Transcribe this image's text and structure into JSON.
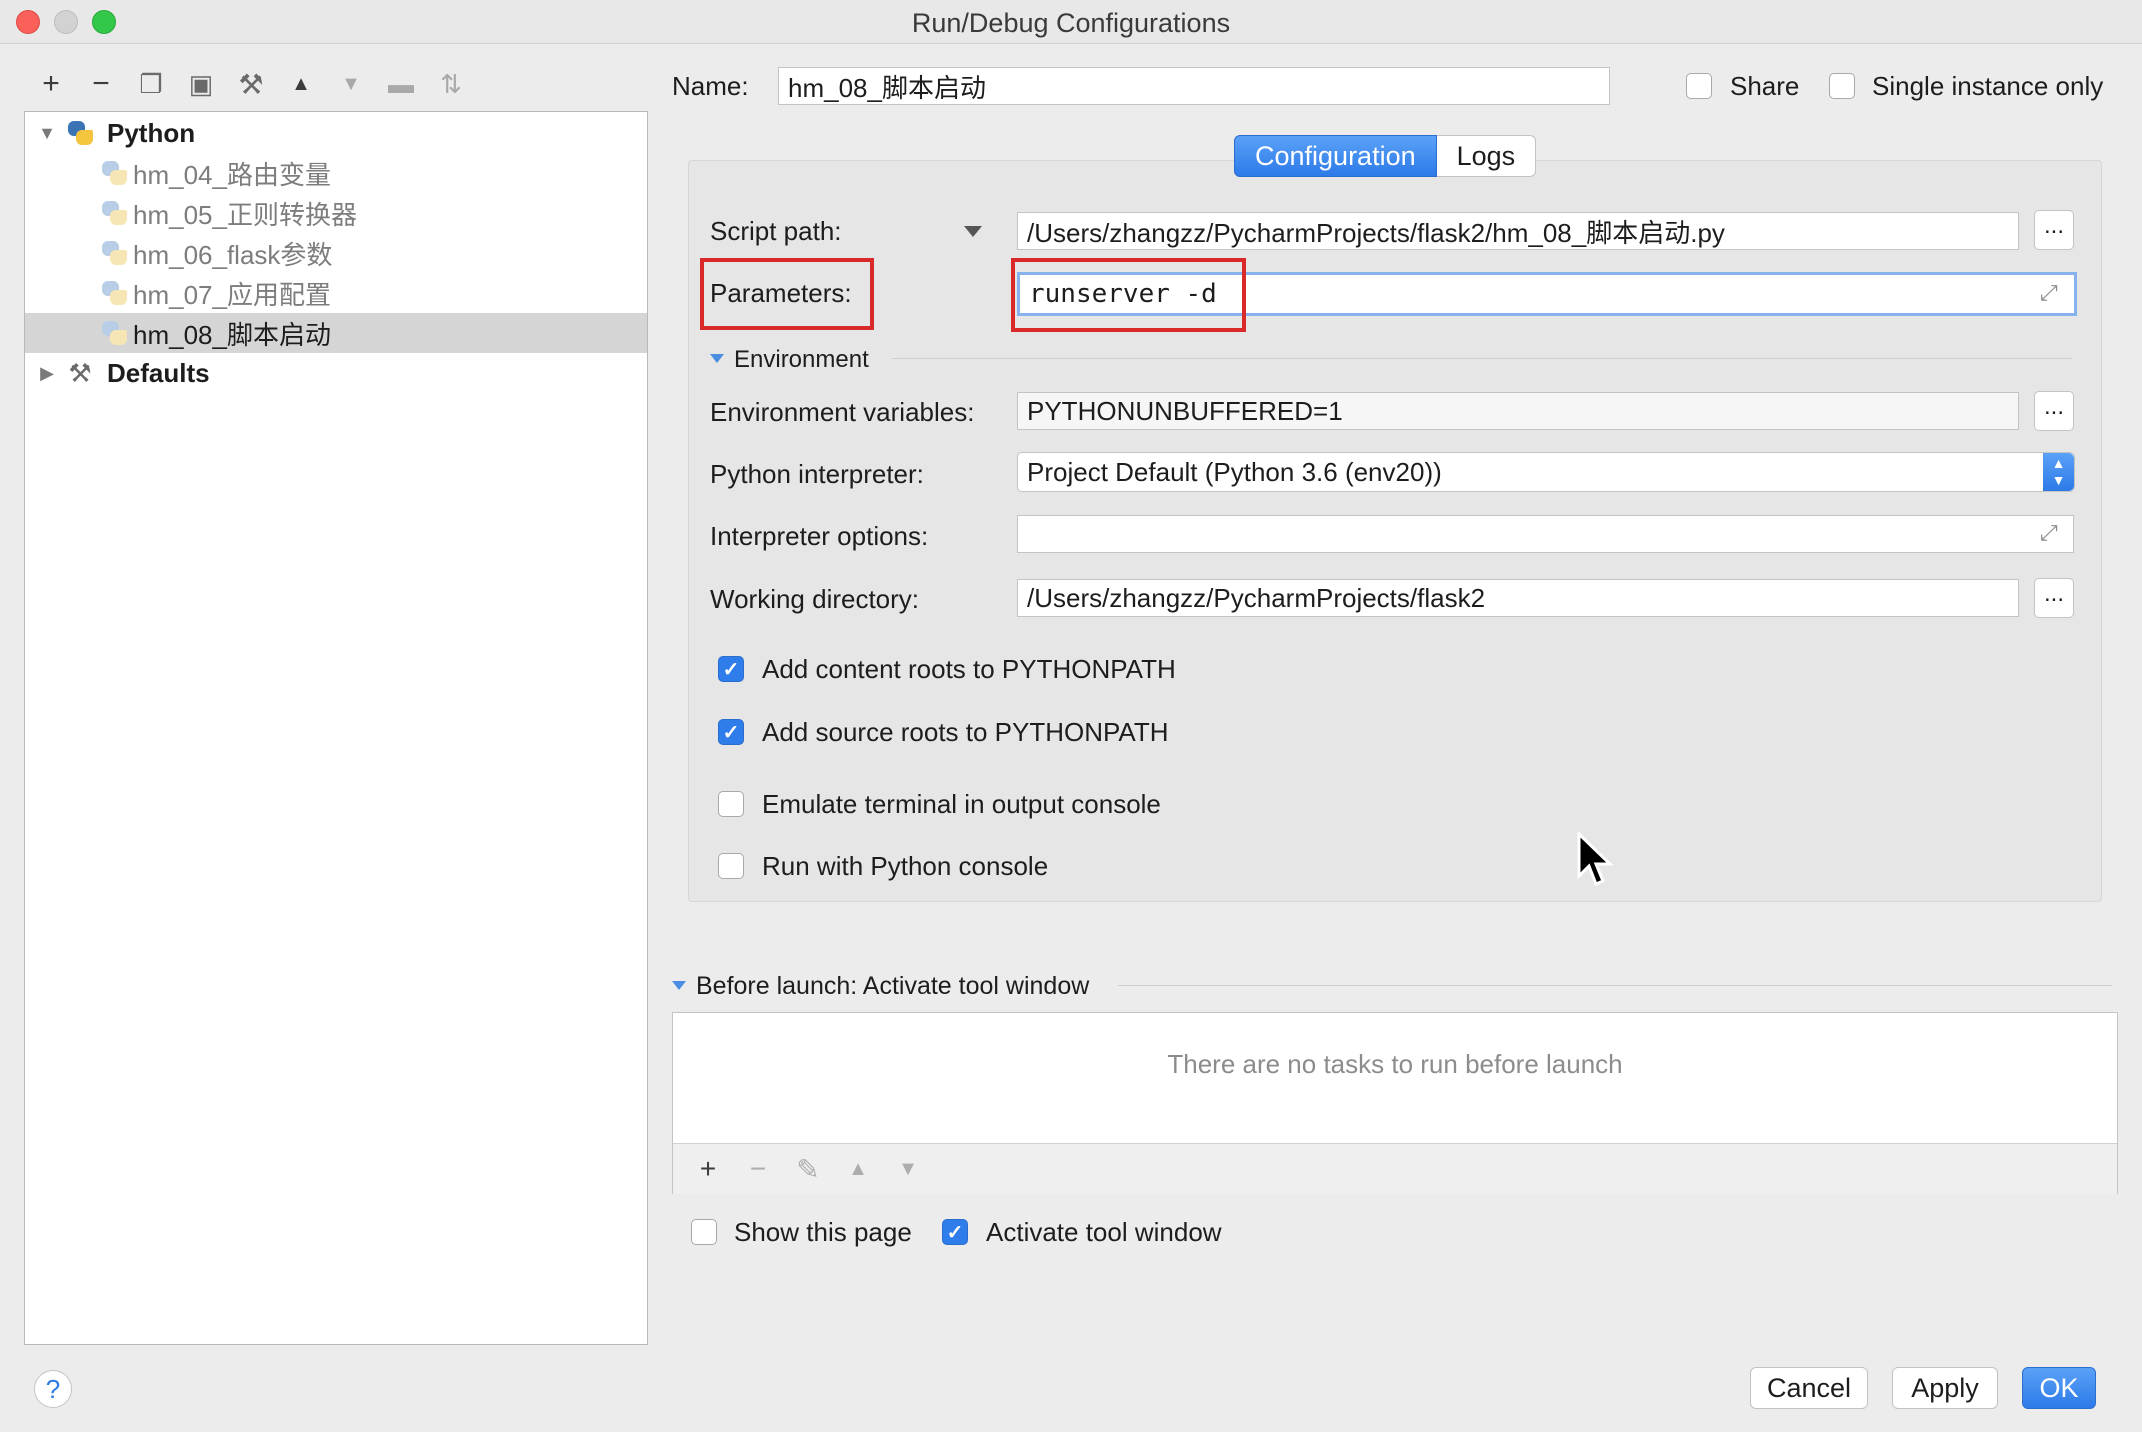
{
  "window": {
    "title": "Run/Debug Configurations"
  },
  "toolbar": {
    "icons": [
      "add-icon",
      "remove-icon",
      "copy-icon",
      "save-icon",
      "settings-icon",
      "move-up-icon",
      "move-down-icon",
      "folder-icon",
      "sort-icon"
    ],
    "glyphs": [
      "+",
      "−",
      "❐",
      "▣",
      "⚒",
      "▲",
      "▼",
      "▬",
      "⇅"
    ]
  },
  "tree": {
    "python_label": "Python",
    "items": [
      "hm_04_路由变量",
      "hm_05_正则转换器",
      "hm_06_flask参数",
      "hm_07_应用配置",
      "hm_08_脚本启动"
    ],
    "selected": "hm_08_脚本启动",
    "defaults_label": "Defaults"
  },
  "header": {
    "name_label": "Name:",
    "name_value": "hm_08_脚本启动",
    "share_label": "Share",
    "single_instance_label": "Single instance only"
  },
  "tabs": {
    "configuration": "Configuration",
    "logs": "Logs"
  },
  "config": {
    "script_path_label": "Script path:",
    "script_path_value": "/Users/zhangzz/PycharmProjects/flask2/hm_08_脚本启动.py",
    "parameters_label": "Parameters:",
    "parameters_value": "runserver -d",
    "environment_label": "Environment",
    "env_vars_label": "Environment variables:",
    "env_vars_value": "PYTHONUNBUFFERED=1",
    "interpreter_label": "Python interpreter:",
    "interpreter_value": "Project Default (Python 3.6 (env20))",
    "interp_options_label": "Interpreter options:",
    "interp_options_value": "",
    "workdir_label": "Working directory:",
    "workdir_value": "/Users/zhangzz/PycharmProjects/flask2",
    "browse_label": "...",
    "add_content_roots_label": "Add content roots to PYTHONPATH",
    "add_source_roots_label": "Add source roots to PYTHONPATH",
    "emulate_terminal_label": "Emulate terminal in output console",
    "run_with_console_label": "Run with Python console",
    "add_content_roots": true,
    "add_source_roots": true,
    "emulate_terminal": false,
    "run_with_console": false
  },
  "before_launch": {
    "label": "Before launch: Activate tool window",
    "empty_text": "There are no tasks to run before launch",
    "show_page_label": "Show this page",
    "activate_tool_window_label": "Activate tool window"
  },
  "footer": {
    "help": "?",
    "cancel": "Cancel",
    "apply": "Apply",
    "ok": "OK"
  },
  "colors": {
    "accent": "#2d7ae8",
    "highlight": "#d9292b"
  }
}
